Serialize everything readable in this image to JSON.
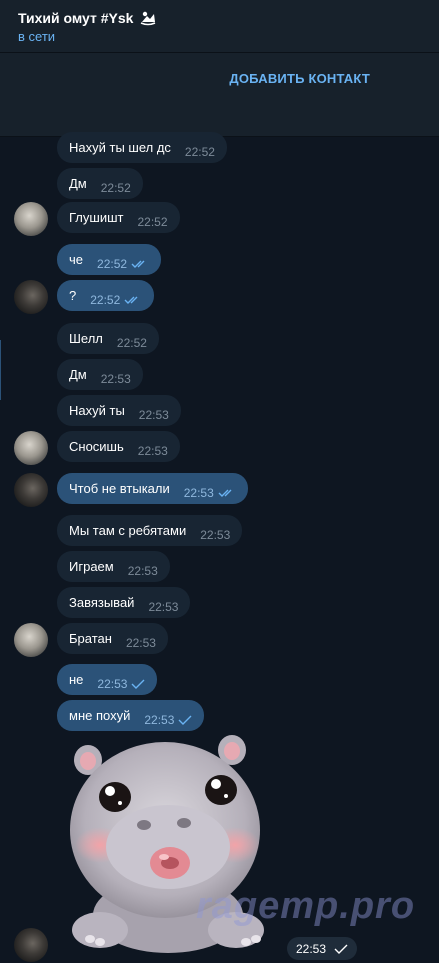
{
  "header": {
    "title": "Тихий омут #Ysk",
    "status": "в сети"
  },
  "action_bar": {
    "add_contact_label": "ДОБАВИТЬ КОНТАКТ"
  },
  "messages": [
    {
      "text": "Нахуй ты шел дс",
      "time": "22:52",
      "direction": "in"
    },
    {
      "text": "Дм",
      "time": "22:52",
      "direction": "in"
    },
    {
      "text": "Глушишт",
      "time": "22:52",
      "direction": "in"
    },
    {
      "text": "че",
      "time": "22:52",
      "direction": "out",
      "read": true
    },
    {
      "text": "?",
      "time": "22:52",
      "direction": "out",
      "read": true
    },
    {
      "text": "Шелл",
      "time": "22:52",
      "direction": "in"
    },
    {
      "text": "Дм",
      "time": "22:53",
      "direction": "in"
    },
    {
      "text": "Нахуй ты",
      "time": "22:53",
      "direction": "in"
    },
    {
      "text": "Сносишь",
      "time": "22:53",
      "direction": "in"
    },
    {
      "text": "Чтоб не втыкали",
      "time": "22:53",
      "direction": "out",
      "read": true
    },
    {
      "text": "Мы там с ребятами",
      "time": "22:53",
      "direction": "in"
    },
    {
      "text": "Играем",
      "time": "22:53",
      "direction": "in"
    },
    {
      "text": "Завязывай",
      "time": "22:53",
      "direction": "in"
    },
    {
      "text": "Братан",
      "time": "22:53",
      "direction": "in"
    },
    {
      "text": "не",
      "time": "22:53",
      "direction": "out",
      "read": false
    },
    {
      "text": "мне похуй",
      "time": "22:53",
      "direction": "out",
      "read": false
    }
  ],
  "sticker": {
    "icon": "hippo-sticker",
    "time": "22:53",
    "read": false
  },
  "watermark": "ragemp.pro"
}
